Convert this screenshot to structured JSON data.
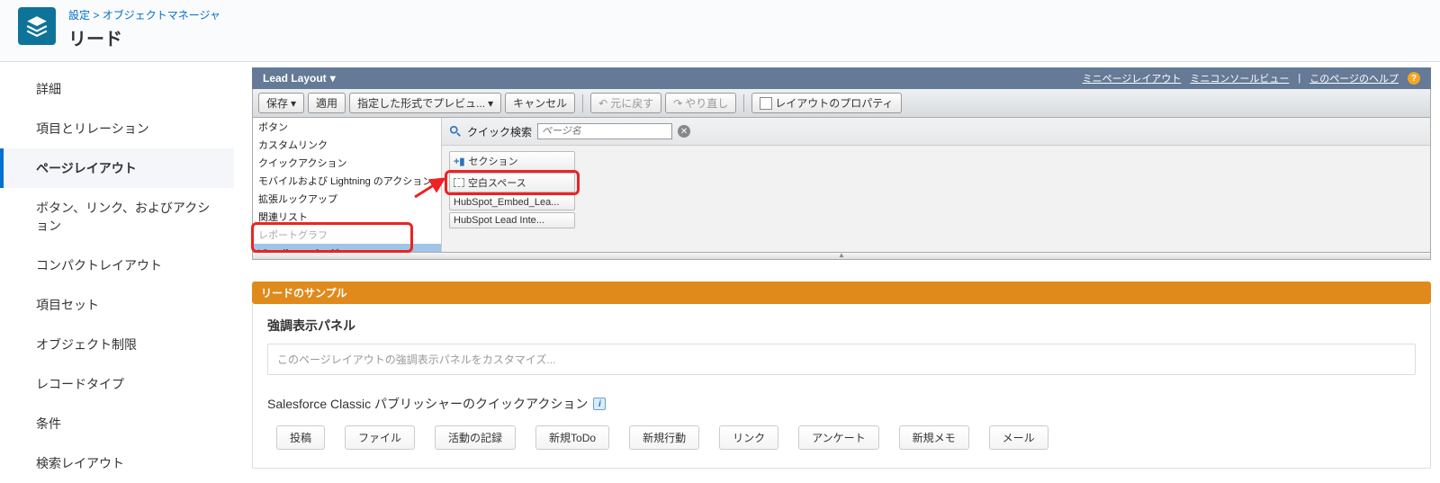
{
  "breadcrumb": {
    "setup": "設定",
    "obj_mgr": "オブジェクトマネージャ"
  },
  "page_title": "リード",
  "sidebar": {
    "items": [
      "詳細",
      "項目とリレーション",
      "ページレイアウト",
      "ボタン、リンク、およびアクション",
      "コンパクトレイアウト",
      "項目セット",
      "オブジェクト制限",
      "レコードタイプ",
      "条件",
      "検索レイアウト"
    ],
    "active_index": 2
  },
  "layout_title": "Lead Layout",
  "titlebar_links": {
    "mini_page": "ミニページレイアウト",
    "mini_console": "ミニコンソールビュー",
    "help": "このページのヘルプ"
  },
  "toolbar": {
    "save": "保存",
    "apply": "適用",
    "preview": "指定した形式でプレビュ...",
    "cancel": "キャンセル",
    "undo": "元に戻す",
    "redo": "やり直し",
    "properties": "レイアウトのプロパティ"
  },
  "categories": [
    "ボタン",
    "カスタムリンク",
    "クイックアクション",
    "モバイルおよび Lightning のアクション",
    "拡張ルックアップ",
    "関連リスト",
    "レポートグラフ",
    "Visualforce ページ"
  ],
  "categories_selected_index": 7,
  "quick_find": {
    "label": "クイック検索",
    "placeholder": "ページ名"
  },
  "palette_items": [
    {
      "label": "セクション"
    },
    {
      "label": "空白スペース"
    },
    {
      "label": "HubSpot_Embed_Lea..."
    },
    {
      "label": "HubSpot Lead Inte..."
    }
  ],
  "sample": {
    "header": "リードのサンプル",
    "panel_title": "強調表示パネル",
    "panel_hint": "このページレイアウトの強調表示パネルをカスタマイズ...",
    "qa_title": "Salesforce Classic パブリッシャーのクイックアクション",
    "chips": [
      "投稿",
      "ファイル",
      "活動の記録",
      "新規ToDo",
      "新規行動",
      "リンク",
      "アンケート",
      "新規メモ",
      "メール"
    ]
  }
}
